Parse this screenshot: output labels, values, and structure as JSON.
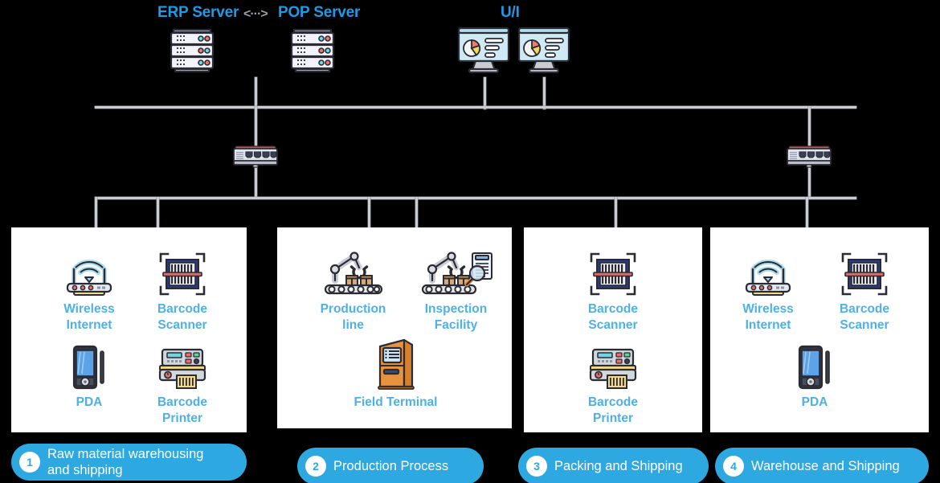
{
  "diagram": {
    "title": "Manufacturing network topology diagram",
    "background": "#000000",
    "accent_blue": "#4fb0e6",
    "header_blue": "#1b9be8",
    "pill_blue": "#2ea8e0",
    "line_gray": "#c9cdd1"
  },
  "headers": {
    "erp": "ERP Server",
    "link_arrow": "<···>",
    "pop": "POP Server",
    "ui": "U/I"
  },
  "top_nodes": [
    {
      "name": "erp-server",
      "icon": "server-rack-icon"
    },
    {
      "name": "pop-server",
      "icon": "server-rack-icon"
    },
    {
      "name": "ui-monitor-left",
      "icon": "monitor-dashboard-icon"
    },
    {
      "name": "ui-monitor-right",
      "icon": "monitor-dashboard-icon"
    }
  ],
  "switches": [
    {
      "name": "network-switch-left",
      "icon": "network-switch-icon"
    },
    {
      "name": "network-switch-right",
      "icon": "network-switch-icon"
    }
  ],
  "panels": [
    {
      "id": "panel-1",
      "devices": [
        {
          "label": "Wireless\nInternet",
          "icon": "wifi-router-icon"
        },
        {
          "label": "Barcode\nScanner",
          "icon": "barcode-scanner-icon"
        },
        {
          "label": "PDA",
          "icon": "pda-icon"
        },
        {
          "label": "Barcode\nPrinter",
          "icon": "barcode-printer-icon"
        }
      ]
    },
    {
      "id": "panel-2",
      "devices": [
        {
          "label": "Production\nline",
          "icon": "robot-arm-icon"
        },
        {
          "label": "Inspection\nFacility",
          "icon": "robot-arm-inspect-icon"
        },
        {
          "label": "Field Terminal",
          "icon": "kiosk-terminal-icon"
        }
      ]
    },
    {
      "id": "panel-3",
      "devices": [
        {
          "label": "Barcode\nScanner",
          "icon": "barcode-scanner-icon"
        },
        {
          "label": "Barcode\nPrinter",
          "icon": "barcode-printer-icon"
        }
      ]
    },
    {
      "id": "panel-4",
      "devices": [
        {
          "label": "Wireless\nInternet",
          "icon": "wifi-router-icon"
        },
        {
          "label": "Barcode\nScanner",
          "icon": "barcode-scanner-icon"
        },
        {
          "label": "PDA",
          "icon": "pda-icon"
        }
      ]
    }
  ],
  "captions": [
    {
      "number": "1",
      "text": "Raw material warehousing\nand shipping"
    },
    {
      "number": "2",
      "text": "Production Process"
    },
    {
      "number": "3",
      "text": "Packing and Shipping"
    },
    {
      "number": "4",
      "text": "Warehouse and Shipping"
    }
  ]
}
